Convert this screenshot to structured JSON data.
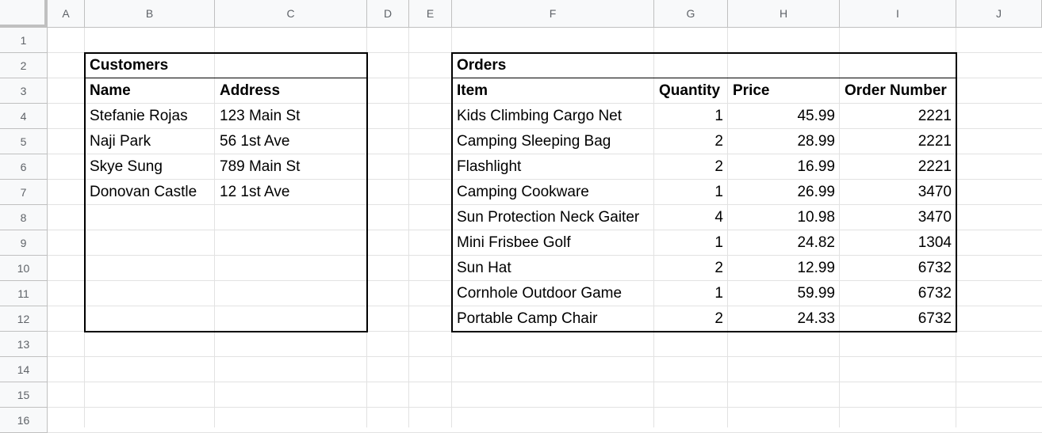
{
  "columns": [
    "A",
    "B",
    "C",
    "D",
    "E",
    "F",
    "G",
    "H",
    "I",
    "J"
  ],
  "rows": [
    "1",
    "2",
    "3",
    "4",
    "5",
    "6",
    "7",
    "8",
    "9",
    "10",
    "11",
    "12",
    "13",
    "14",
    "15",
    "16"
  ],
  "customers": {
    "title": "Customers",
    "headers": [
      "Name",
      "Address"
    ],
    "rows": [
      [
        "Stefanie Rojas",
        "123 Main St"
      ],
      [
        "Naji Park",
        "56 1st Ave"
      ],
      [
        "Skye Sung",
        "789 Main St"
      ],
      [
        "Donovan Castle",
        "12 1st Ave"
      ]
    ]
  },
  "orders": {
    "title": "Orders",
    "headers": [
      "Item",
      "Quantity",
      "Price",
      "Order Number"
    ],
    "rows": [
      [
        "Kids Climbing Cargo Net",
        "1",
        "45.99",
        "2221"
      ],
      [
        "Camping Sleeping Bag",
        "2",
        "28.99",
        "2221"
      ],
      [
        "Flashlight",
        "2",
        "16.99",
        "2221"
      ],
      [
        "Camping Cookware",
        "1",
        "26.99",
        "3470"
      ],
      [
        "Sun Protection Neck Gaiter",
        "4",
        "10.98",
        "3470"
      ],
      [
        "Mini Frisbee Golf",
        "1",
        "24.82",
        "1304"
      ],
      [
        "Sun Hat",
        "2",
        "12.99",
        "6732"
      ],
      [
        "Cornhole Outdoor Game",
        "1",
        "59.99",
        "6732"
      ],
      [
        "Portable Camp Chair",
        "2",
        "24.33",
        "6732"
      ]
    ]
  }
}
